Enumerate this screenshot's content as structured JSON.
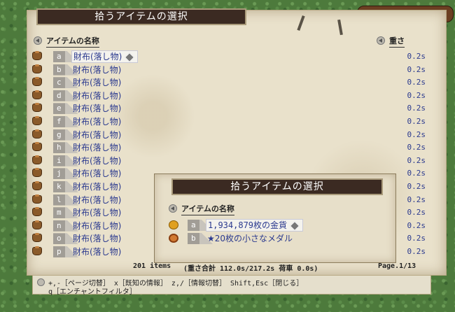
{
  "main_window": {
    "title": "拾うアイテムの選択",
    "header_name": "アイテムの名称",
    "header_weight": "重さ",
    "items": [
      {
        "key": "a",
        "name": "財布(落し物)",
        "weight": "0.2s",
        "selected": true
      },
      {
        "key": "b",
        "name": "財布(落し物)",
        "weight": "0.2s"
      },
      {
        "key": "c",
        "name": "財布(落し物)",
        "weight": "0.2s"
      },
      {
        "key": "d",
        "name": "財布(落し物)",
        "weight": "0.2s"
      },
      {
        "key": "e",
        "name": "財布(落し物)",
        "weight": "0.2s"
      },
      {
        "key": "f",
        "name": "財布(落し物)",
        "weight": "0.2s"
      },
      {
        "key": "g",
        "name": "財布(落し物)",
        "weight": "0.2s"
      },
      {
        "key": "h",
        "name": "財布(落し物)",
        "weight": "0.2s"
      },
      {
        "key": "i",
        "name": "財布(落し物)",
        "weight": "0.2s"
      },
      {
        "key": "j",
        "name": "財布(落し物)",
        "weight": "0.2s"
      },
      {
        "key": "k",
        "name": "財布(落し物)",
        "weight": "0.2s"
      },
      {
        "key": "l",
        "name": "財布(落し物)",
        "weight": "0.2s"
      },
      {
        "key": "m",
        "name": "財布(落し物)",
        "weight": "0.2s"
      },
      {
        "key": "n",
        "name": "財布(落し物)",
        "weight": "0.2s"
      },
      {
        "key": "o",
        "name": "財布(落し物)",
        "weight": "0.2s"
      },
      {
        "key": "p",
        "name": "財布(落し物)",
        "weight": "0.2s"
      }
    ],
    "footer_count": "201 items",
    "footer_weight": "(重さ合計 112.0s/217.2s  荷車 0.0s)",
    "footer_page": "Page.1/13"
  },
  "help": {
    "line1": "+,-［ページ切替］ x［既知の情報］ z,/［情報切替］ Shift,Esc［閉じる］",
    "line2": "q［エンチャントフィルタ］"
  },
  "popup": {
    "title": "拾うアイテムの選択",
    "header_name": "アイテムの名称",
    "items": [
      {
        "key": "a",
        "name": "1,934,879枚の金貨",
        "icon": "gold-coin-icon",
        "selected": true
      },
      {
        "key": "b",
        "name": "★20枚の小さなメダル",
        "icon": "small-medal-icon"
      }
    ]
  }
}
